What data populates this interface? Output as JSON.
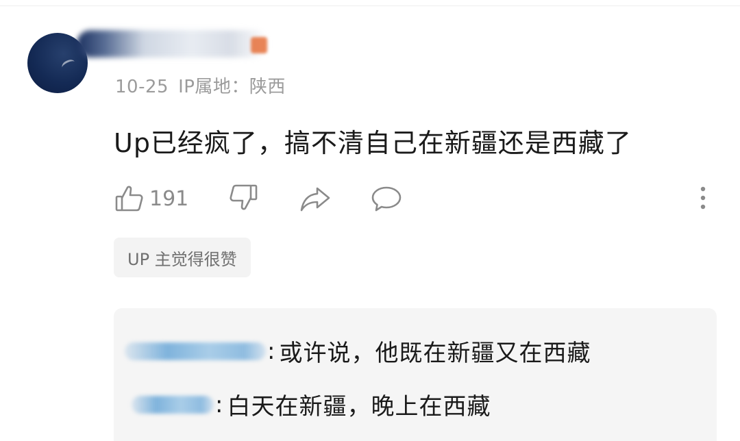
{
  "comment": {
    "date": "10-25",
    "ip_location": "IP属地：陕西",
    "text": "Up已经疯了，搞不清自己在新疆还是西藏了",
    "like_count": "191",
    "up_badge": "UP 主觉得很赞"
  },
  "actions": {
    "like_icon": "thumbs-up-icon",
    "dislike_icon": "thumbs-down-icon",
    "share_icon": "share-icon",
    "reply_icon": "comment-bubble-icon",
    "more_icon": "more-vertical-icon"
  },
  "replies": [
    {
      "separator": ":",
      "text": "或许说，他既在新疆又在西藏"
    },
    {
      "separator": ":",
      "text": "白天在新疆，晚上在西藏"
    }
  ],
  "colors": {
    "text_primary": "#1a1a1a",
    "text_secondary": "#9b9b9b",
    "icon": "#8a8a8a",
    "badge_bg": "#f3f3f3",
    "reply_bg": "#f5f5f5",
    "reply_name_blur": "#7fb3dc"
  }
}
